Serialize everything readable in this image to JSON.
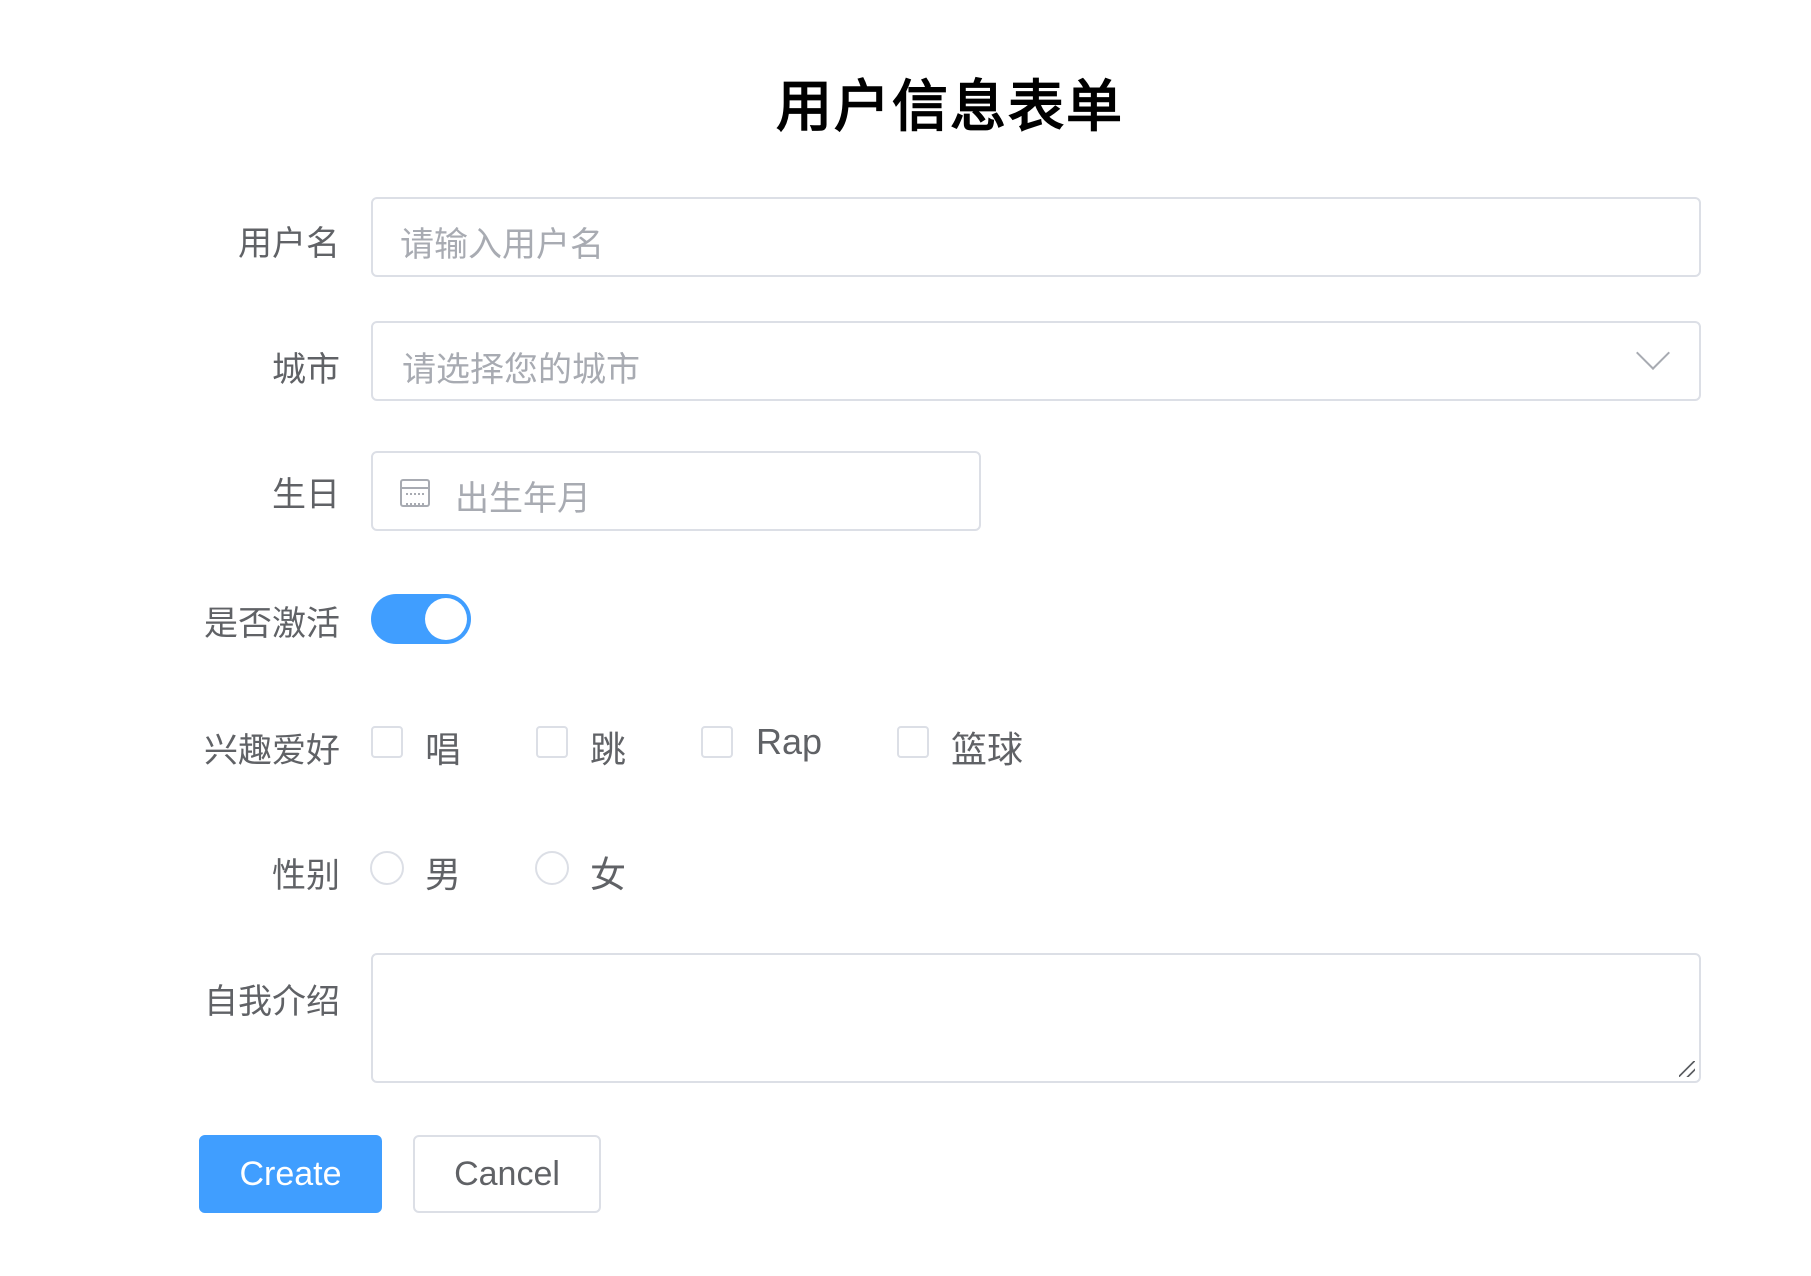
{
  "form": {
    "title": "用户信息表单",
    "username": {
      "label": "用户名",
      "placeholder": "请输入用户名",
      "value": ""
    },
    "city": {
      "label": "城市",
      "placeholder": "请选择您的城市",
      "icon": "chevron-down-icon"
    },
    "birthday": {
      "label": "生日",
      "placeholder": "出生年月",
      "icon": "calendar-icon"
    },
    "active": {
      "label": "是否激活",
      "checked": true,
      "color": "#409eff"
    },
    "hobbies": {
      "label": "兴趣爱好",
      "options": [
        {
          "label": "唱",
          "checked": false
        },
        {
          "label": "跳",
          "checked": false
        },
        {
          "label": "Rap",
          "checked": false
        },
        {
          "label": "篮球",
          "checked": false
        }
      ]
    },
    "gender": {
      "label": "性别",
      "options": [
        {
          "label": "男",
          "checked": false
        },
        {
          "label": "女",
          "checked": false
        }
      ]
    },
    "intro": {
      "label": "自我介绍",
      "value": ""
    }
  },
  "actions": {
    "create_label": "Create",
    "cancel_label": "Cancel",
    "primary_color": "#409eff"
  }
}
